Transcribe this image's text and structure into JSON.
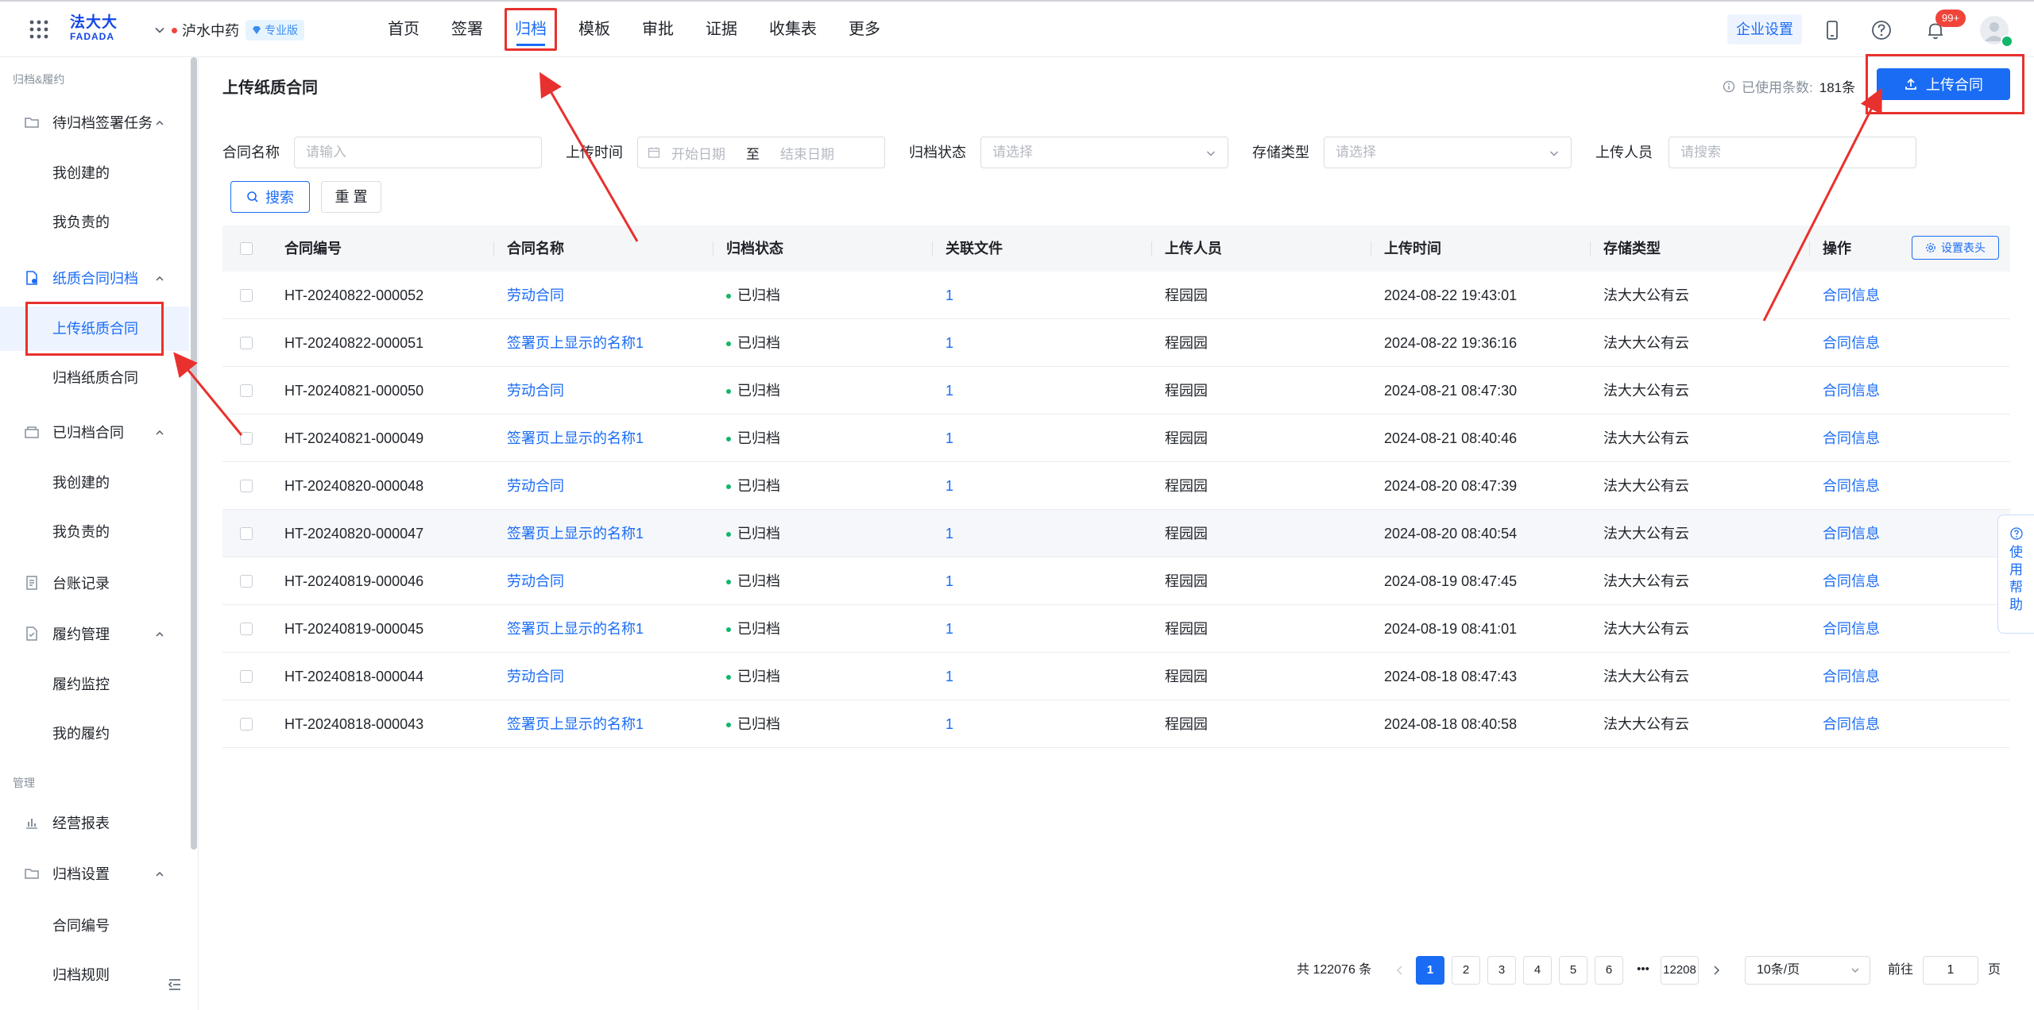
{
  "header": {
    "logo_cn": "法大大",
    "logo_en": "FADADA",
    "org_name": "泸水中药",
    "org_badge": "专业版",
    "nav": [
      "首页",
      "签署",
      "归档",
      "模板",
      "审批",
      "证据",
      "收集表",
      "更多"
    ],
    "active_nav": "归档",
    "enterprise_settings": "企业设置",
    "notification_count": "99+"
  },
  "sidebar": {
    "group_archive": "归档&履约",
    "group_manage": "管理",
    "items": {
      "pending": "待归档签署任务",
      "pending_created": "我创建的",
      "pending_responsible": "我负责的",
      "paper": "纸质合同归档",
      "paper_upload": "上传纸质合同",
      "paper_archive": "归档纸质合同",
      "archived": "已归档合同",
      "archived_created": "我创建的",
      "archived_responsible": "我负责的",
      "ledger": "台账记录",
      "perf": "履约管理",
      "perf_monitor": "履约监控",
      "perf_mine": "我的履约",
      "report": "经营报表",
      "settings": "归档设置",
      "contract_no": "合同编号",
      "rules": "归档规则"
    }
  },
  "main": {
    "title": "上传纸质合同",
    "usage_label": "已使用条数:",
    "usage_count": "181条",
    "upload_button": "上传合同"
  },
  "filters": {
    "contract_name_label": "合同名称",
    "contract_name_placeholder": "请输入",
    "upload_time_label": "上传时间",
    "start_date": "开始日期",
    "to": "至",
    "end_date": "结束日期",
    "archive_status_label": "归档状态",
    "archive_status_placeholder": "请选择",
    "storage_type_label": "存储类型",
    "storage_type_placeholder": "请选择",
    "uploader_label": "上传人员",
    "uploader_placeholder": "请搜索",
    "search_button": "搜索",
    "reset_button": "重 置"
  },
  "table": {
    "columns": [
      "合同编号",
      "合同名称",
      "归档状态",
      "关联文件",
      "上传人员",
      "上传时间",
      "存储类型",
      "操作"
    ],
    "set_header_button": "设置表头",
    "rows": [
      {
        "id": "HT-20240822-000052",
        "name": "劳动合同",
        "status": "已归档",
        "files": "1",
        "uploader": "程园园",
        "time": "2024-08-22 19:43:01",
        "storage": "法大大公有云",
        "action": "合同信息"
      },
      {
        "id": "HT-20240822-000051",
        "name": "签署页上显示的名称1",
        "status": "已归档",
        "files": "1",
        "uploader": "程园园",
        "time": "2024-08-22 19:36:16",
        "storage": "法大大公有云",
        "action": "合同信息"
      },
      {
        "id": "HT-20240821-000050",
        "name": "劳动合同",
        "status": "已归档",
        "files": "1",
        "uploader": "程园园",
        "time": "2024-08-21 08:47:30",
        "storage": "法大大公有云",
        "action": "合同信息"
      },
      {
        "id": "HT-20240821-000049",
        "name": "签署页上显示的名称1",
        "status": "已归档",
        "files": "1",
        "uploader": "程园园",
        "time": "2024-08-21 08:40:46",
        "storage": "法大大公有云",
        "action": "合同信息"
      },
      {
        "id": "HT-20240820-000048",
        "name": "劳动合同",
        "status": "已归档",
        "files": "1",
        "uploader": "程园园",
        "time": "2024-08-20 08:47:39",
        "storage": "法大大公有云",
        "action": "合同信息"
      },
      {
        "id": "HT-20240820-000047",
        "name": "签署页上显示的名称1",
        "status": "已归档",
        "files": "1",
        "uploader": "程园园",
        "time": "2024-08-20 08:40:54",
        "storage": "法大大公有云",
        "action": "合同信息"
      },
      {
        "id": "HT-20240819-000046",
        "name": "劳动合同",
        "status": "已归档",
        "files": "1",
        "uploader": "程园园",
        "time": "2024-08-19 08:47:45",
        "storage": "法大大公有云",
        "action": "合同信息"
      },
      {
        "id": "HT-20240819-000045",
        "name": "签署页上显示的名称1",
        "status": "已归档",
        "files": "1",
        "uploader": "程园园",
        "time": "2024-08-19 08:41:01",
        "storage": "法大大公有云",
        "action": "合同信息"
      },
      {
        "id": "HT-20240818-000044",
        "name": "劳动合同",
        "status": "已归档",
        "files": "1",
        "uploader": "程园园",
        "time": "2024-08-18 08:47:43",
        "storage": "法大大公有云",
        "action": "合同信息"
      },
      {
        "id": "HT-20240818-000043",
        "name": "签署页上显示的名称1",
        "status": "已归档",
        "files": "1",
        "uploader": "程园园",
        "time": "2024-08-18 08:40:58",
        "storage": "法大大公有云",
        "action": "合同信息"
      }
    ]
  },
  "pagination": {
    "total": "共 122076 条",
    "pages": [
      "1",
      "2",
      "3",
      "4",
      "5",
      "6"
    ],
    "ellipsis": "•••",
    "last": "12208",
    "page_size": "10条/页",
    "goto_label": "前往",
    "goto_value": "1",
    "page_suffix": "页"
  },
  "help": {
    "chars": [
      "使",
      "用",
      "帮",
      "助"
    ]
  },
  "colors": {
    "primary": "#1a6cf5",
    "annotation_red": "#e8312e",
    "success": "#12b76a"
  }
}
